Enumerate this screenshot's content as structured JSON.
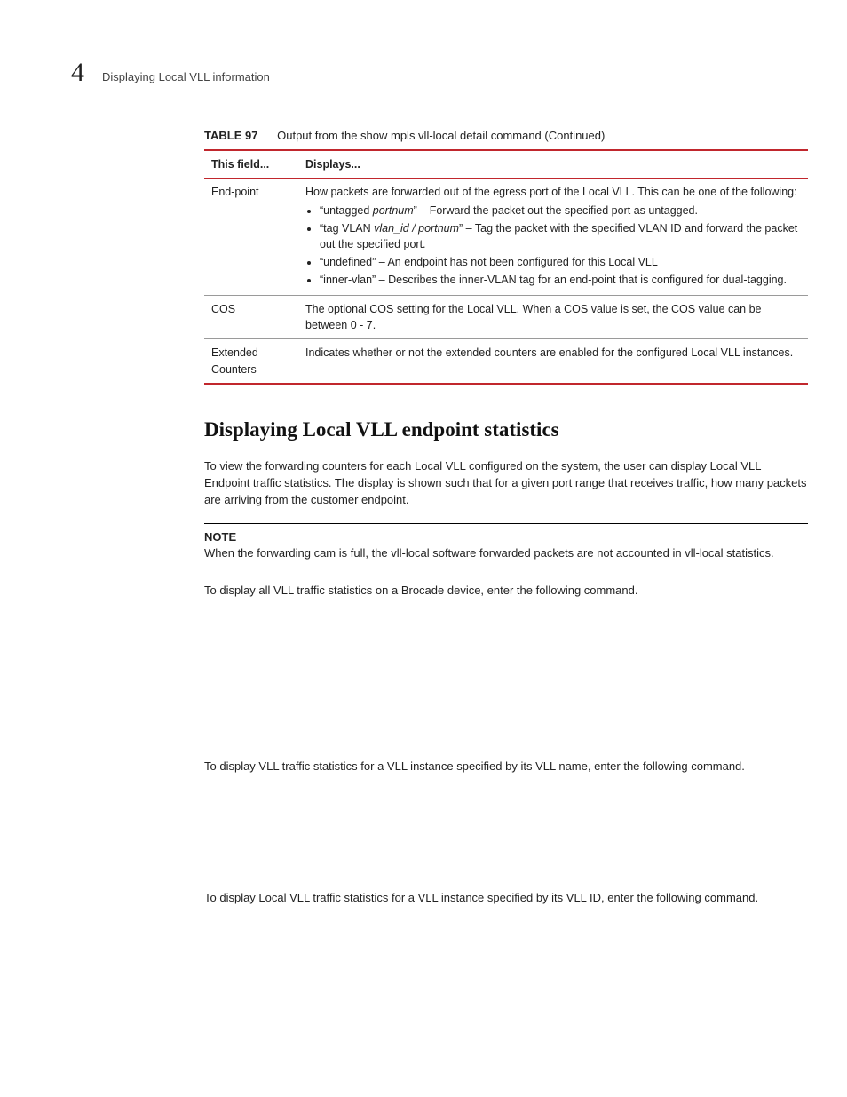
{
  "header": {
    "chapter_number": "4",
    "chapter_title": "Displaying Local VLL information"
  },
  "table": {
    "label": "TABLE 97",
    "caption": "Output from the show mpls vll-local detail command  (Continued)",
    "columns": [
      "This field...",
      "Displays..."
    ],
    "rows": [
      {
        "field": "End-point",
        "intro": "How packets are forwarded out of the egress port of the Local VLL. This can be one of the following:",
        "bullets": [
          "“untagged portnum” – Forward the packet out the specified port as untagged.",
          "“tag VLAN vlan_id / portnum” – Tag the packet with the specified VLAN ID and forward the packet out the specified port.",
          "“undefined” – An endpoint has not been configured for this Local VLL",
          "“inner-vlan” – Describes the inner-VLAN tag for an end-point that is configured for dual-tagging."
        ]
      },
      {
        "field": "COS",
        "text": "The optional COS setting for the Local VLL. When a COS value is set, the COS value can be between 0 - 7."
      },
      {
        "field": "Extended Counters",
        "text": "Indicates whether or not the extended counters are enabled for the configured Local VLL instances."
      }
    ]
  },
  "section": {
    "heading": "Displaying Local VLL endpoint statistics",
    "para1": "To view the forwarding counters for each Local VLL configured on the system, the user can display Local VLL Endpoint traffic statistics. The display is shown such that for a given port range that receives traffic, how many packets are arriving from the customer endpoint.",
    "note_label": "NOTE",
    "note_text": "When the forwarding cam is full, the vll-local software forwarded packets are not accounted in vll-local statistics.",
    "para2": "To display all VLL traffic statistics on a Brocade device, enter the following command.",
    "para3": "To display VLL traffic statistics for a VLL instance specified by its VLL name, enter the following command.",
    "para4": "To display Local VLL traffic statistics for a VLL instance specified by its VLL ID, enter the following command."
  }
}
